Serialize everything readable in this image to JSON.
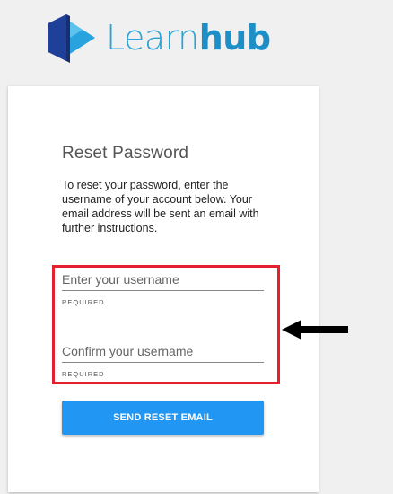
{
  "brand": {
    "name_light": "Learn",
    "name_bold": "hub",
    "color": "#2a9ec9",
    "icon": "cube-logo-icon"
  },
  "card": {
    "title": "Reset Password",
    "description": "To reset your password, enter the username of your account below. Your email address will be sent an email with further instructions."
  },
  "fields": {
    "username": {
      "placeholder": "Enter your username",
      "hint": "REQUIRED"
    },
    "confirm": {
      "placeholder": "Confirm your username",
      "hint": "REQUIRED"
    }
  },
  "button": {
    "label": "SEND RESET EMAIL",
    "color": "#2196f3"
  },
  "annotation": {
    "highlight_color": "#e4202e",
    "arrow_icon": "left-arrow-icon"
  }
}
